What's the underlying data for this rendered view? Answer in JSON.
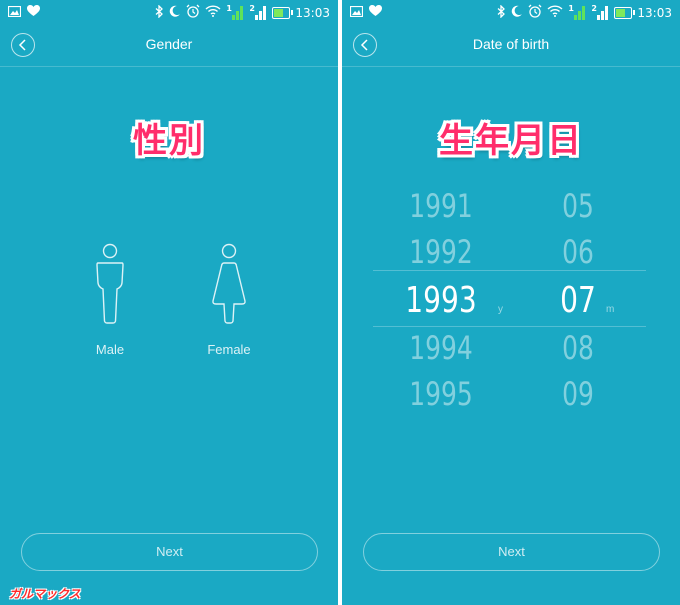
{
  "status_bar": {
    "time": "13:03",
    "sim1": "1",
    "sim2": "2"
  },
  "left_screen": {
    "title": "Gender",
    "caption": "性別",
    "options": [
      {
        "label": "Male"
      },
      {
        "label": "Female"
      }
    ],
    "next_label": "Next"
  },
  "right_screen": {
    "title": "Date of birth",
    "caption": "生年月日",
    "years": [
      "1991",
      "1992",
      "1993",
      "1994",
      "1995"
    ],
    "months": [
      "05",
      "06",
      "07",
      "08",
      "09"
    ],
    "selected_year": "1993",
    "selected_month": "07",
    "year_unit": "y",
    "month_unit": "m",
    "next_label": "Next"
  },
  "watermark": "ガルマックス",
  "colors": {
    "background": "#1aa9c4",
    "caption": "#ff2d6b",
    "watermark": "#ff2a2a"
  },
  "icons": {
    "status_left": [
      "gallery-icon",
      "heart-icon"
    ],
    "status_right": [
      "bluetooth-icon",
      "moon-icon",
      "alarm-icon",
      "wifi-icon",
      "signal-icon",
      "battery-charging-icon"
    ],
    "back": "chevron-left-icon",
    "male": "male-figure-icon",
    "female": "female-figure-icon"
  }
}
